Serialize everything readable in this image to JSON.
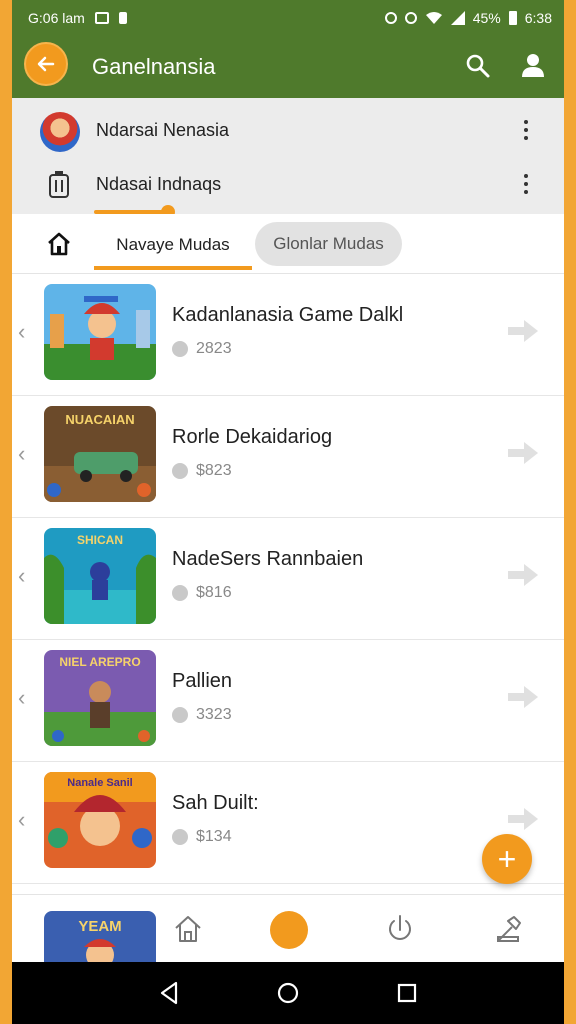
{
  "status_bar": {
    "time_left": "G:06 lam",
    "battery": "45%",
    "time_right": "6:38"
  },
  "app_bar": {
    "title": "Ganelnansia"
  },
  "accounts": [
    {
      "label": "Ndarsai Nenasia"
    },
    {
      "label": "Ndasai Indnaqs"
    }
  ],
  "tabs": {
    "active": "Navaye Mudas",
    "inactive": "Glonlar Mudas"
  },
  "games": [
    {
      "title": "Kadanlanasia Game Dalkl",
      "meta": "2823"
    },
    {
      "title": "Rorle Dekaidariog",
      "meta": "$823"
    },
    {
      "title": "NadeSers Rannbaien",
      "meta": "$816"
    },
    {
      "title": "Pallien",
      "meta": "3323"
    },
    {
      "title": "Sah Duilt:",
      "meta": "$134"
    }
  ],
  "thumbnails": [
    {
      "text": "",
      "bg": "#3a8e2f"
    },
    {
      "text": "NUACAIAN",
      "bg": "#6b4a2a"
    },
    {
      "text": "SHICAN",
      "bg": "#1f9bc2"
    },
    {
      "text": "NIEL AREPRO",
      "bg": "#7b5bb0"
    },
    {
      "text": "Nanale Sanil",
      "bg": "#e0632a"
    }
  ],
  "peek": {
    "text": "YEAM"
  },
  "fab": {
    "label": "+"
  },
  "colors": {
    "accent": "#f29a1e",
    "app_bar": "#4f7a2c"
  }
}
